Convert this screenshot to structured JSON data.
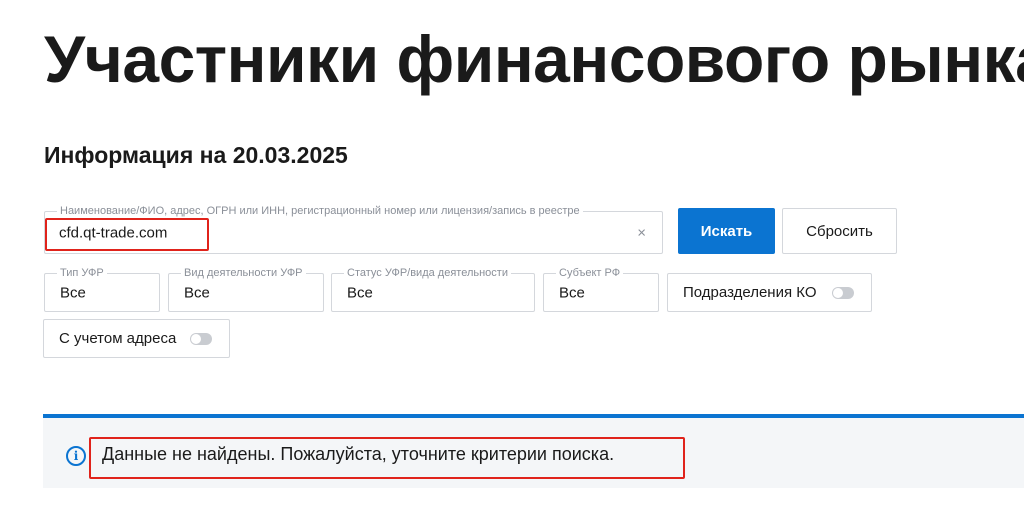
{
  "page": {
    "title": "Участники финансового рынка",
    "info_date": "Информация на 20.03.2025"
  },
  "search": {
    "legend": "Наименование/ФИО, адрес, ОГРН или ИНН, регистрационный номер или лицензия/запись в реестре",
    "value": "cfd.qt-trade.com",
    "clear_icon": "×",
    "search_button": "Искать",
    "reset_button": "Сбросить"
  },
  "filters": [
    {
      "legend": "Тип УФР",
      "value": "Все"
    },
    {
      "legend": "Вид деятельности УФР",
      "value": "Все"
    },
    {
      "legend": "Статус УФР/вида деятельности",
      "value": "Все"
    },
    {
      "legend": "Субъект РФ",
      "value": "Все"
    }
  ],
  "toggles": [
    {
      "label": "Подразделения КО",
      "enabled": false
    },
    {
      "label": "С учетом адреса",
      "enabled": false
    }
  ],
  "result": {
    "icon": "info-icon",
    "icon_glyph": "i",
    "message": "Данные не найдены. Пожалуйста, уточните критерии поиска."
  },
  "colors": {
    "accent": "#0b74d1",
    "highlight": "#e0231b"
  }
}
